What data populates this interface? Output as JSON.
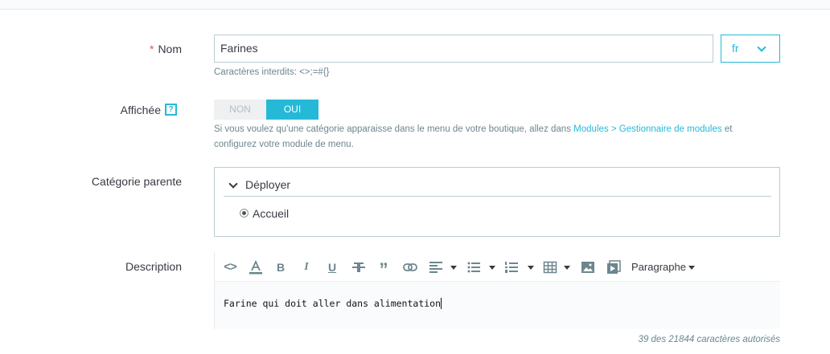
{
  "form": {
    "name": {
      "required_mark": "*",
      "label": "Nom",
      "value": "Farines",
      "language": "fr",
      "help": "Caractères interdits: <>;=#{}"
    },
    "displayed": {
      "label": "Affichée",
      "help_icon": "?",
      "off_label": "NON",
      "on_label": "OUI",
      "state": "on",
      "help_before": "Si vous voulez qu'une catégorie apparaisse dans le menu de votre boutique, allez dans",
      "help_link": "Modules > Gestionnaire de modules",
      "help_after": "et",
      "help_line2": "configurez votre module de menu."
    },
    "parent": {
      "label": "Catégorie parente",
      "expand_label": "Déployer",
      "selected": "Accueil"
    },
    "description": {
      "label": "Description",
      "toolbar": {
        "code_icon": "<>",
        "bold": "B",
        "italic": "I",
        "underline": "U",
        "quote": "”",
        "paragraph": "Paragraphe"
      },
      "content": "Farine qui doit aller dans alimentation",
      "counter": "39 des 21844 caractères autorisés"
    }
  },
  "colors": {
    "accent": "#25b9d7",
    "required": "#e0574f",
    "text": "#363a41",
    "muted": "#6c868e"
  }
}
